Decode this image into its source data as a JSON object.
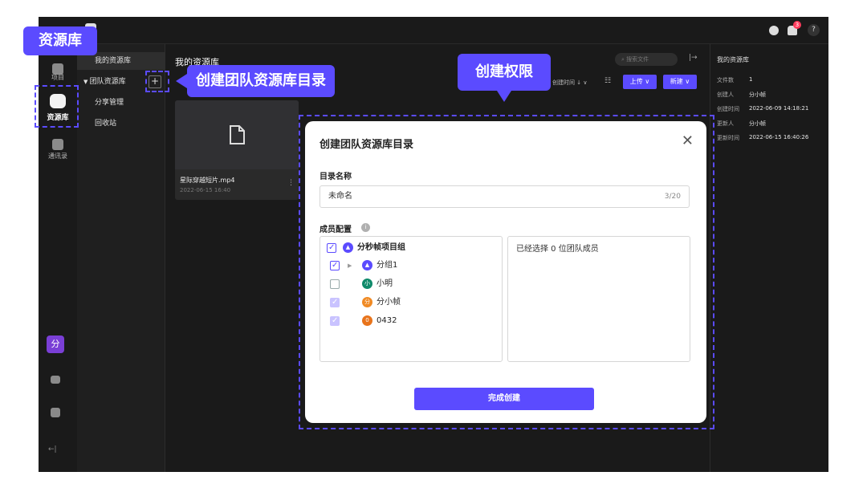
{
  "app": {
    "top_right": {
      "notification_count": "3",
      "help_label": "?"
    }
  },
  "leftnav": {
    "items": [
      {
        "label": "项目"
      },
      {
        "label": "资源库"
      },
      {
        "label": "通讯录"
      }
    ],
    "avatar_label": "分",
    "collapse_label": "←|"
  },
  "tree": {
    "items": [
      {
        "label": "我的资源库"
      },
      {
        "label": "团队资源库"
      },
      {
        "label": "分享管理"
      },
      {
        "label": "回收站"
      }
    ]
  },
  "main": {
    "title": "我的资源库",
    "search_placeholder": "搜索文件",
    "sort_label": "创建时间 ↓ ∨",
    "upload_label": "上传 ∨",
    "new_label": "新建 ∨",
    "card": {
      "filename": "星际穿越短片.mp4",
      "date": "2022-06-15 16:40"
    }
  },
  "info": {
    "title": "我的资源库",
    "rows": [
      {
        "key": "文件数",
        "value": "1"
      },
      {
        "key": "创建人",
        "value": "分小帧"
      },
      {
        "key": "创建时间",
        "value": "2022-06-09 14:18:21"
      },
      {
        "key": "更新人",
        "value": "分小帧"
      },
      {
        "key": "更新时间",
        "value": "2022-06-15 16:40:26"
      }
    ]
  },
  "modal": {
    "title": "创建团队资源库目录",
    "close_label": "✕",
    "name_label": "目录名称",
    "name_value": "未命名",
    "name_count": "3/20",
    "members_label": "成员配置",
    "group": "分秒帧项目组",
    "subgroup": "分组1",
    "members": [
      {
        "avatar": "小",
        "name": "小明",
        "color": "#0f8a6a",
        "checked": "off"
      },
      {
        "avatar": "分",
        "name": "分小帧",
        "color": "#f08a24",
        "checked": "dim"
      },
      {
        "avatar": "0",
        "name": "0432",
        "color": "#e8741c",
        "checked": "dim"
      }
    ],
    "selected_text": "已经选择 0 位团队成员",
    "submit_label": "完成创建"
  },
  "annotations": {
    "library": "资源库",
    "create_dir": "创建团队资源库目录",
    "permission": "创建权限"
  },
  "colors": {
    "accent": "#5b4bff",
    "dark_bg": "#1a1a1a"
  }
}
